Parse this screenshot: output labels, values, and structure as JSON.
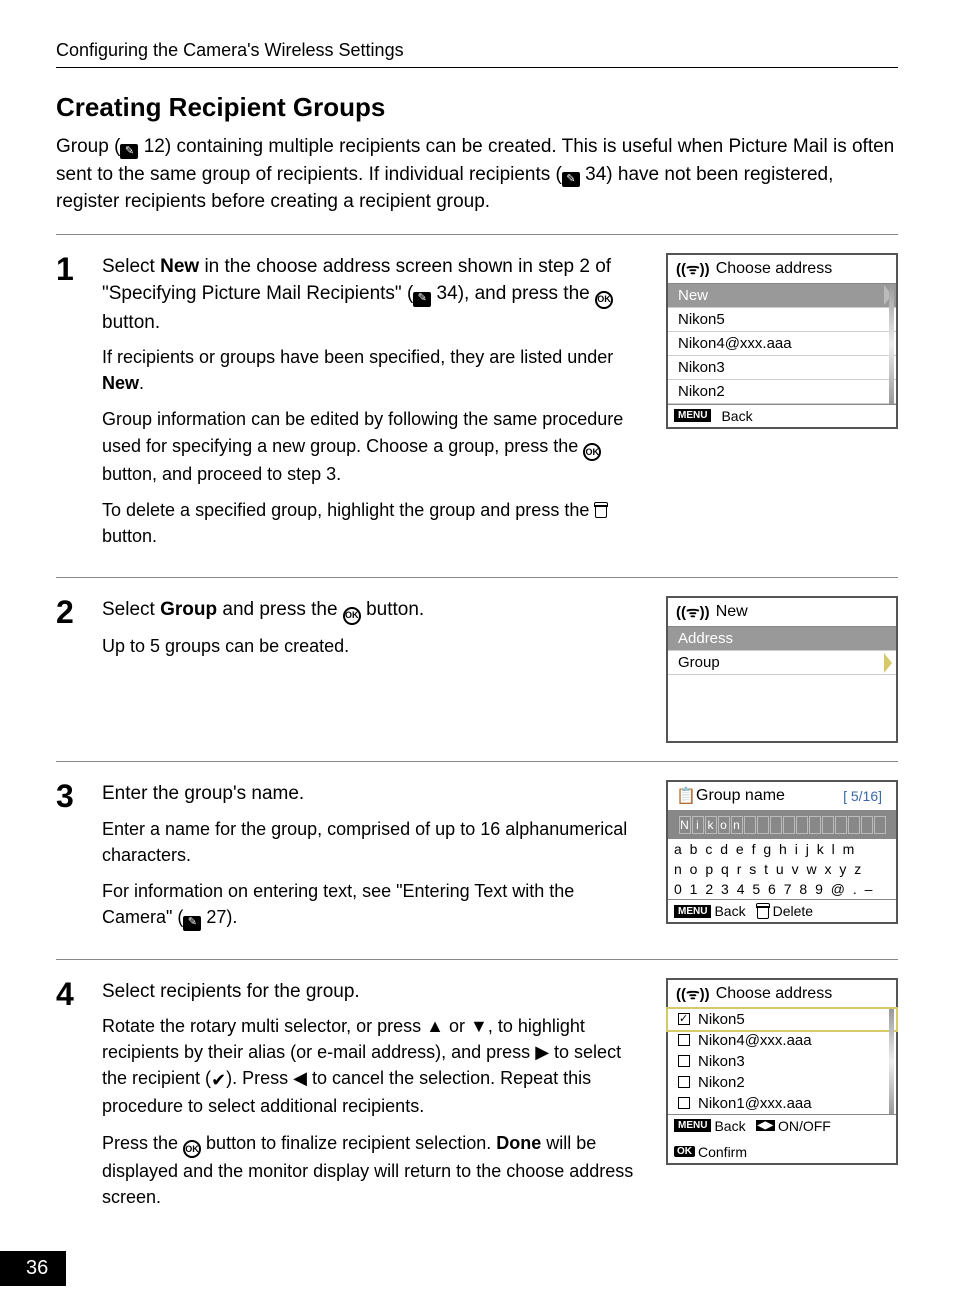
{
  "breadcrumb": "Configuring the Camera's Wireless Settings",
  "section_title": "Creating Recipient Groups",
  "intro_parts": {
    "a": "Group (",
    "ref1": " 12) containing multiple recipients can be created. This is useful when Picture Mail is often sent to the same group of recipients. If individual recipients (",
    "ref2": " 34) have not been registered, register recipients before creating a recipient group."
  },
  "steps": {
    "s1": {
      "num": "1",
      "lead_a": "Select ",
      "lead_b": "New",
      "lead_c": " in the choose address screen shown in step 2 of \"Specifying Picture Mail Recipients\" (",
      "lead_d": " 34), and press the ",
      "lead_e": " button.",
      "p1a": "If recipients or groups have been specified, they are listed under ",
      "p1b": "New",
      "p1c": ".",
      "p2a": "Group information can be edited by following the same procedure used for specifying a new group. Choose a group, press the ",
      "p2b": " button, and proceed to step 3.",
      "p3a": "To delete a specified group, highlight the group and press the ",
      "p3b": " button."
    },
    "s2": {
      "num": "2",
      "lead_a": "Select ",
      "lead_b": "Group",
      "lead_c": " and press the ",
      "lead_d": " button.",
      "p1": "Up to 5 groups can be created."
    },
    "s3": {
      "num": "3",
      "lead": "Enter the group's name.",
      "p1": "Enter a name for the group, comprised of up to 16 alphanumerical characters.",
      "p2a": "For information on entering text, see \"Entering Text with the Camera\" (",
      "p2b": " 27)."
    },
    "s4": {
      "num": "4",
      "lead": "Select recipients for the group.",
      "p1a": "Rotate the rotary multi selector, or press ",
      "p1b": " or ",
      "p1c": ", to highlight recipients by their alias (or e-mail address), and press ",
      "p1d": " to select the recipient (",
      "p1e": "). Press ",
      "p1f": " to cancel the selection. Repeat this procedure to select additional recipients.",
      "p2a": "Press the ",
      "p2b": " button to finalize recipient selection. ",
      "p2c": "Done",
      "p2d": " will be displayed and the monitor display will return to the choose address screen."
    }
  },
  "figures": {
    "f1": {
      "title": "Choose address",
      "items": [
        "New",
        "Nikon5",
        "Nikon4@xxx.aaa",
        "Nikon3",
        "Nikon2"
      ],
      "foot_back": "Back",
      "menu_label": "MENU"
    },
    "f2": {
      "title": "New",
      "items": [
        "Address",
        "Group"
      ]
    },
    "f3": {
      "title": "Group name",
      "counter": "[  5/16]",
      "entry": [
        "N",
        "i",
        "k",
        "o",
        "n"
      ],
      "kb_r1": "a b c d e f g h i j k l m",
      "kb_r2": "n o p q r s t u v w x y z",
      "kb_r3": "0 1 2 3 4 5 6 7 8 9 @ . –",
      "foot_back": "Back",
      "foot_delete": "Delete",
      "menu_label": "MENU"
    },
    "f4": {
      "title": "Choose address",
      "items": [
        {
          "label": "Nikon5",
          "checked": true
        },
        {
          "label": "Nikon4@xxx.aaa",
          "checked": false
        },
        {
          "label": "Nikon3",
          "checked": false
        },
        {
          "label": "Nikon2",
          "checked": false
        },
        {
          "label": "Nikon1@xxx.aaa",
          "checked": false
        }
      ],
      "foot_back": "Back",
      "foot_onoff": "ON/OFF",
      "foot_confirm": "Confirm",
      "menu_label": "MENU",
      "ok_label": "OK"
    }
  },
  "page_number": "36"
}
